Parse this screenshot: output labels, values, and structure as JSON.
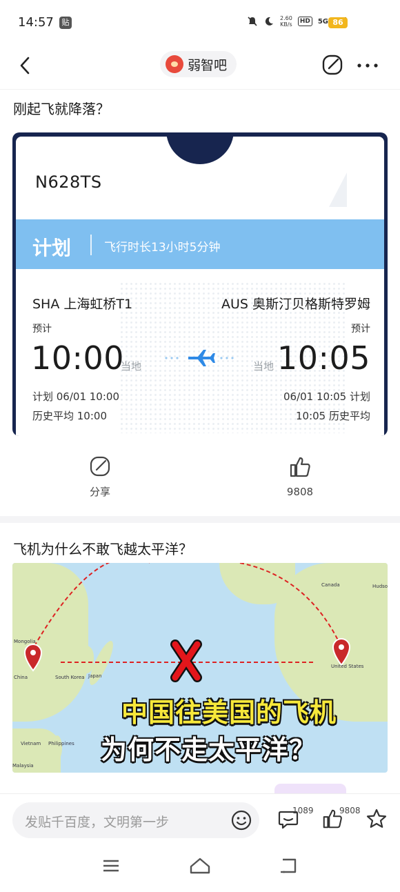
{
  "status_bar": {
    "time": "14:57",
    "app_badge": "贴",
    "net_speed_value": "2.60",
    "net_speed_unit": "KB/s",
    "hd": "HD",
    "network": "5G",
    "battery": "86"
  },
  "header": {
    "forum_name": "弱智吧",
    "icons": [
      "back-icon",
      "share-icon",
      "more-icon"
    ]
  },
  "post1": {
    "title": "刚起飞就降落？",
    "flight": {
      "registration": "N628TS",
      "status_label": "计划",
      "duration": "飞行时长13小时5分钟",
      "departure": {
        "code_city": "SHA 上海虹桥T1",
        "est_label": "预计",
        "time": "10:00",
        "local_label": "当地",
        "planned": "计划 06/01 10:00",
        "history": "历史平均 10:00"
      },
      "arrival": {
        "code_city": "AUS 奥斯汀贝格斯特罗姆",
        "est_label": "预计",
        "time": "10:05",
        "local_label": "当地",
        "planned": "06/01 10:05 计划",
        "history": "10:05 历史平均"
      }
    },
    "actions": {
      "share_label": "分享",
      "like_count": "9808"
    }
  },
  "post2": {
    "title": "飞机为什么不敢飞越太平洋？",
    "map": {
      "line1": "中国往美国的飞机",
      "line2": "为何不走太平洋？",
      "labels": {
        "mongolia": "Mongolia",
        "china": "China",
        "south_korea": "South Korea",
        "japan": "Japan",
        "vietnam": "Vietnam",
        "philippines": "Philippines",
        "malaysia": "Malaysia",
        "canada": "Canada",
        "hudson": "Hudson",
        "usa": "United States"
      }
    }
  },
  "bottom_bar": {
    "input_placeholder": "发贴千百度，文明第一步",
    "comment_count": "1089",
    "like_count": "9808"
  },
  "colors": {
    "card_navy": "#17254f",
    "plan_bar": "#7fbff0",
    "plane_blue": "#2f8ae6",
    "battery": "#f2b61d"
  }
}
